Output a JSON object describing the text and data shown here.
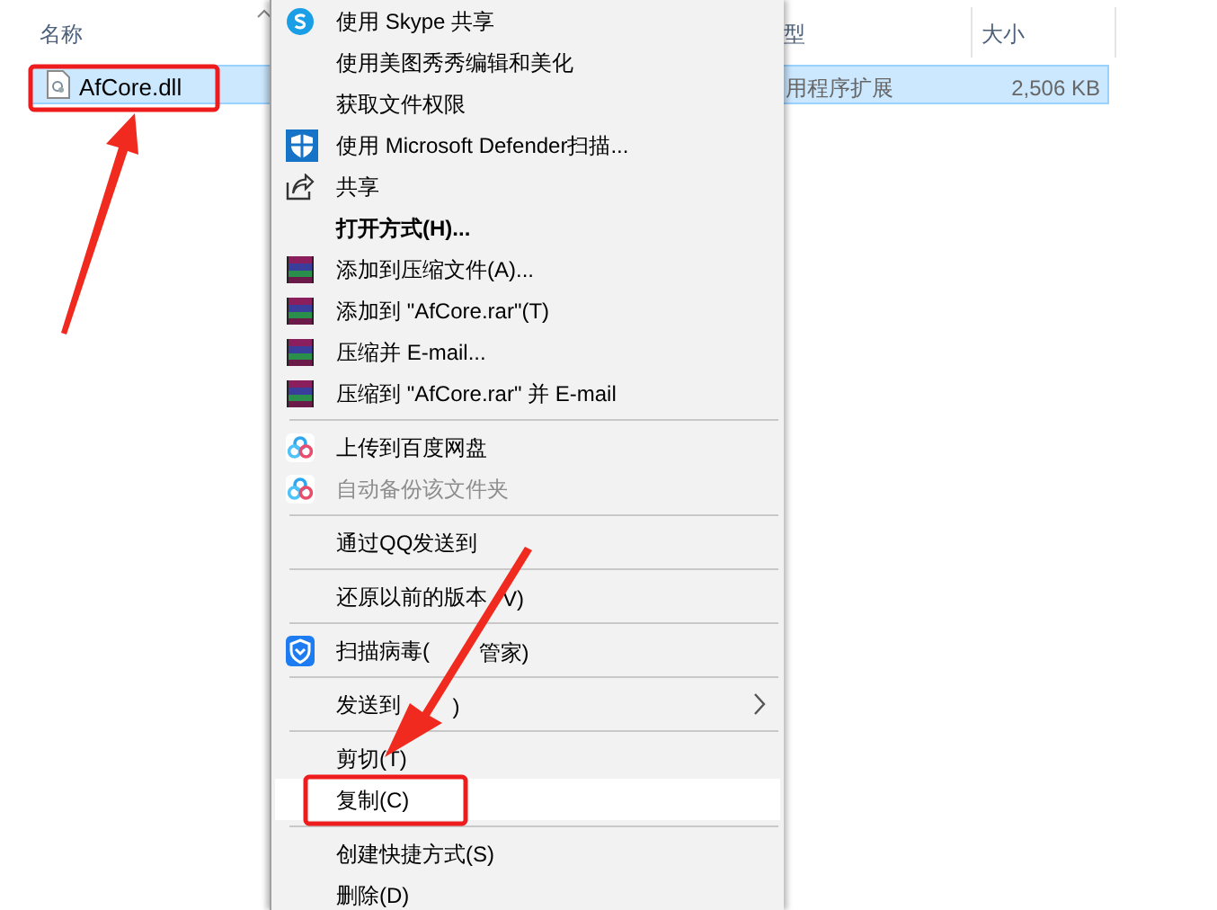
{
  "file_list": {
    "columns": [
      {
        "label": "名称",
        "sorted": true
      },
      {
        "label": "型"
      },
      {
        "label": "大小"
      }
    ],
    "rows": [
      {
        "name": "AfCore.dll",
        "type": "用程序扩展",
        "size": "2,506 KB",
        "selected": true
      }
    ]
  },
  "context_menu": {
    "items": [
      {
        "kind": "skype",
        "label": "使用 Skype 共享",
        "disabled": false,
        "selected": false
      },
      {
        "kind": "plain",
        "label": "使用美图秀秀编辑和美化",
        "disabled": false,
        "selected": false
      },
      {
        "kind": "plain",
        "label": "获取文件权限",
        "disabled": false,
        "selected": false
      },
      {
        "kind": "defender",
        "label": "使用 Microsoft Defender扫描...",
        "disabled": false,
        "selected": false
      },
      {
        "kind": "share",
        "label": "共享",
        "disabled": false,
        "selected": false
      },
      {
        "kind": "default",
        "label": "打开方式(H)...",
        "disabled": false,
        "selected": false
      },
      {
        "kind": "winrar",
        "label": "添加到压缩文件(A)...",
        "disabled": false,
        "selected": false
      },
      {
        "kind": "winrar",
        "label": "添加到 \"AfCore.rar\"(T)",
        "disabled": false,
        "selected": false
      },
      {
        "kind": "winrar",
        "label": "压缩并 E-mail...",
        "disabled": false,
        "selected": false
      },
      {
        "kind": "winrar",
        "label": "压缩到 \"AfCore.rar\" 并 E-mail",
        "disabled": false,
        "selected": false
      },
      {
        "kind": "separator"
      },
      {
        "kind": "baidu",
        "label": "上传到百度网盘",
        "disabled": false,
        "selected": false
      },
      {
        "kind": "baidu",
        "label": "自动备份该文件夹",
        "disabled": true,
        "selected": false
      },
      {
        "kind": "separator"
      },
      {
        "kind": "plain",
        "label": "通过QQ发送到",
        "disabled": false,
        "selected": false
      },
      {
        "kind": "separator"
      },
      {
        "kind": "plain",
        "label": "还原以前的版本",
        "label_tail": "V)",
        "disabled": false,
        "selected": false
      },
      {
        "kind": "separator"
      },
      {
        "kind": "shield",
        "label": "扫描病毒(",
        "label_tail": "管家)",
        "disabled": false,
        "selected": false
      },
      {
        "kind": "separator"
      },
      {
        "kind": "submenu",
        "label": "发送到",
        "label_tail": ")",
        "disabled": false,
        "selected": false
      },
      {
        "kind": "separator"
      },
      {
        "kind": "plain",
        "label": "剪切(T)",
        "disabled": false,
        "selected": false
      },
      {
        "kind": "plain",
        "label": "复制(C)",
        "disabled": false,
        "selected": true
      },
      {
        "kind": "separator"
      },
      {
        "kind": "plain",
        "label": "创建快捷方式(S)",
        "disabled": false,
        "selected": false
      },
      {
        "kind": "plain",
        "label": "删除(D)",
        "disabled": false,
        "selected": false
      }
    ]
  }
}
